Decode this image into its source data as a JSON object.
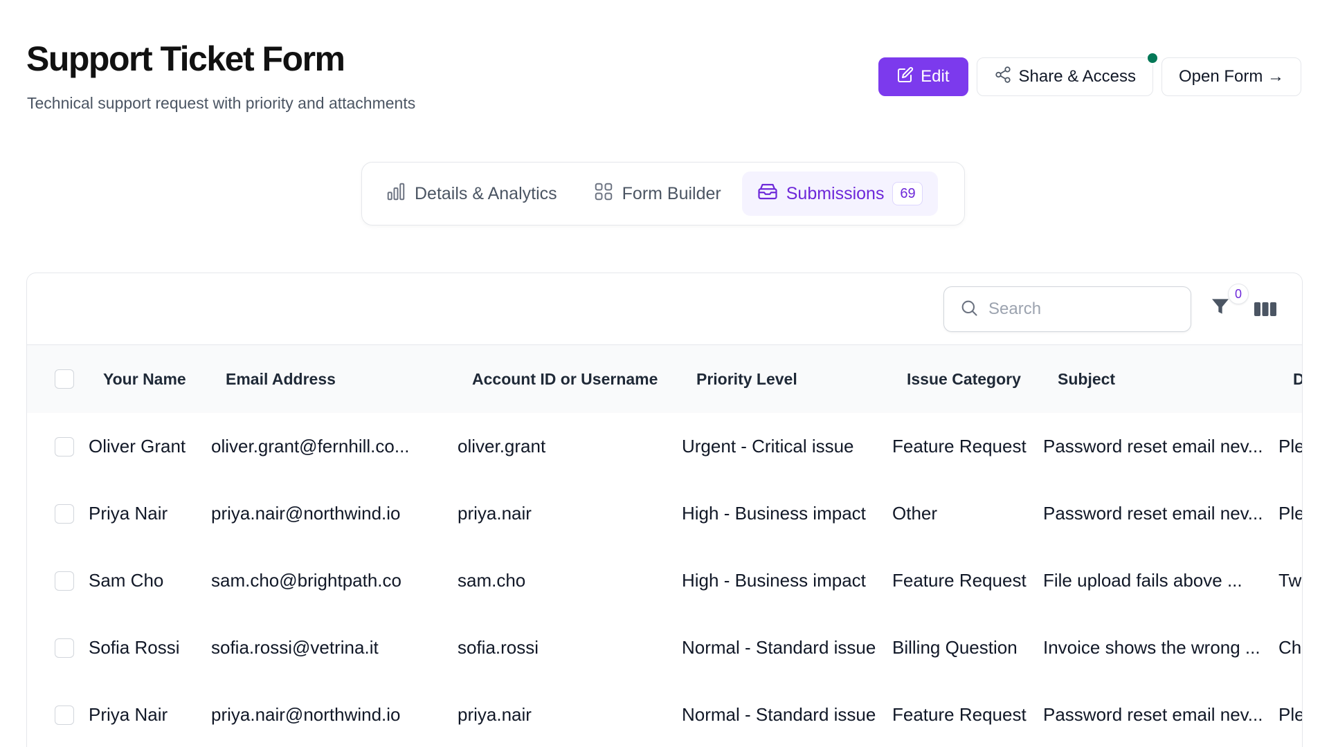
{
  "header": {
    "title": "Support Ticket Form",
    "subtitle": "Technical support request with priority and attachments"
  },
  "actions": {
    "edit_label": "Edit",
    "share_label": "Share & Access",
    "open_label": "Open Form →"
  },
  "tabs": [
    {
      "label": "Details & Analytics",
      "icon": "bar-chart-icon"
    },
    {
      "label": "Form Builder",
      "icon": "grid-icon"
    },
    {
      "label": "Submissions",
      "icon": "inbox-icon",
      "count": "69",
      "active": true
    }
  ],
  "toolbar": {
    "search_placeholder": "Search",
    "filter_count": "0"
  },
  "table": {
    "columns": [
      "Your Name",
      "Email Address",
      "Account ID or Username",
      "Priority Level",
      "Issue Category",
      "Subject",
      "D"
    ],
    "rows": [
      [
        "Oliver Grant",
        "oliver.grant@fernhill.co...",
        "oliver.grant",
        "Urgent - Critical issue",
        "Feature Request",
        "Password reset email nev...",
        "Ple"
      ],
      [
        "Priya Nair",
        "priya.nair@northwind.io",
        "priya.nair",
        "High - Business impact",
        "Other",
        "Password reset email nev...",
        "Ple"
      ],
      [
        "Sam Cho",
        "sam.cho@brightpath.co",
        "sam.cho",
        "High - Business impact",
        "Feature Request",
        "File upload fails above ...",
        "Tw"
      ],
      [
        "Sofia Rossi",
        "sofia.rossi@vetrina.it",
        "sofia.rossi",
        "Normal - Standard issue",
        "Billing Question",
        "Invoice shows the wrong ...",
        "Ch"
      ],
      [
        "Priya Nair",
        "priya.nair@northwind.io",
        "priya.nair",
        "Normal - Standard issue",
        "Feature Request",
        "Password reset email nev...",
        "Ple"
      ]
    ]
  },
  "colors": {
    "accent": "#7c3aed",
    "status_dot": "#047857"
  }
}
